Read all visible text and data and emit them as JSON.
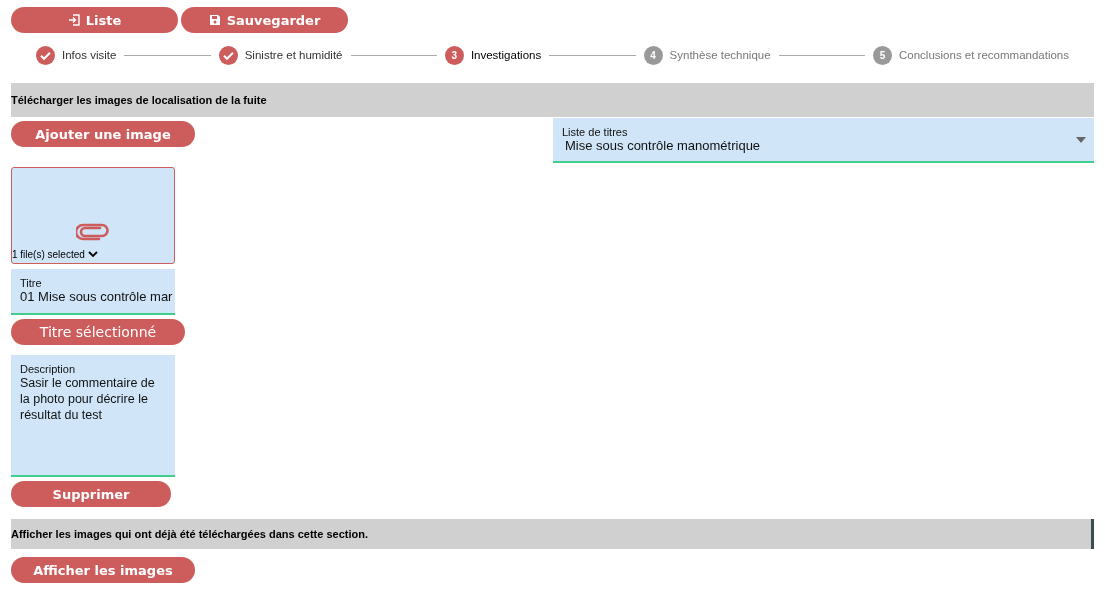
{
  "toolbar": [
    {
      "label": "Liste",
      "kind": "list"
    },
    {
      "label": "Sauvegarder",
      "kind": "save"
    }
  ],
  "steps": [
    {
      "label": "Infos visite",
      "completed": true,
      "selected": false
    },
    {
      "label": "Sinistre et humidité",
      "completed": true,
      "selected": false
    },
    {
      "number": "3",
      "label": "Investigations",
      "completed": false,
      "selected": true
    },
    {
      "number": "4",
      "label": "Synthèse technique",
      "completed": false,
      "selected": false
    },
    {
      "number": "5",
      "label": "Conclusions et recommandations",
      "completed": false,
      "selected": false
    }
  ],
  "upload_section": {
    "title": "Télécharger les images de localisation de la fuite",
    "add_button": "Ajouter une image",
    "title_list": {
      "label": "Liste de titres",
      "value": "Mise sous contrôle manométrique"
    },
    "file_picker": {
      "status": "1 file(s) selected"
    },
    "title_field": {
      "label": "Titre",
      "value": "01 Mise sous contrôle mar"
    },
    "title_button": "Titre sélectionné",
    "description_field": {
      "label": "Description",
      "value": "Sasir le commentaire de la photo pour décrire le résultat du test"
    },
    "delete_button": "Supprimer"
  },
  "view_section": {
    "title": "Afficher les images qui ont déjà été téléchargées dans cette section.",
    "button": "Afficher les images"
  }
}
